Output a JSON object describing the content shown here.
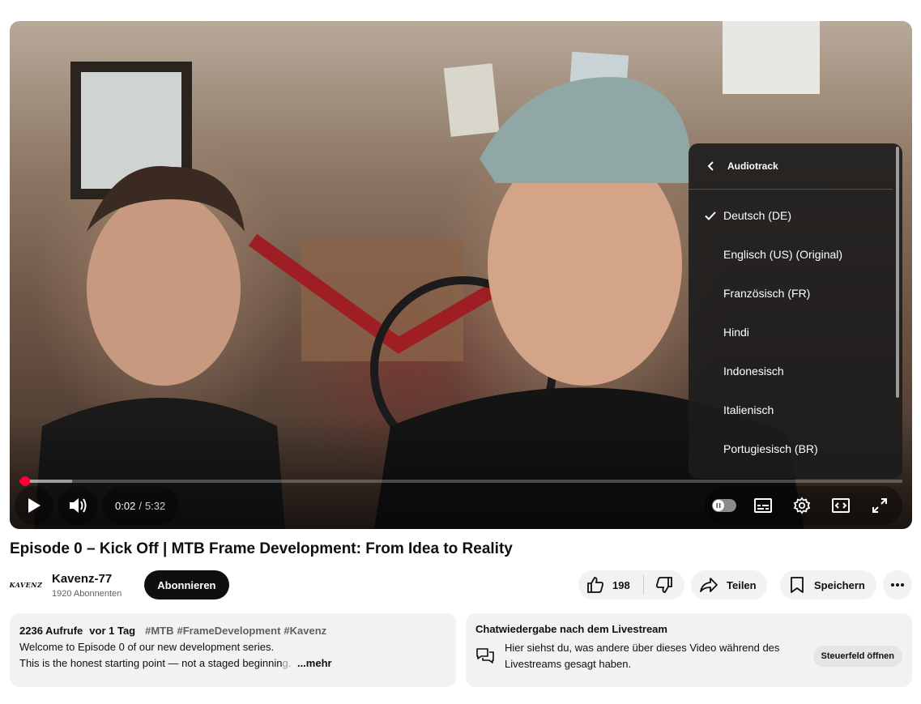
{
  "player": {
    "audio_menu": {
      "title": "Audiotrack",
      "selected_index": 0,
      "tracks": [
        "Deutsch (DE)",
        "Englisch (US) (Original)",
        "Französisch (FR)",
        "Hindi",
        "Indonesisch",
        "Italienisch",
        "Portugiesisch (BR)"
      ]
    },
    "time": {
      "current": "0:02",
      "separator": "/",
      "duration": "5:32"
    },
    "progress": {
      "played_fraction": 0.006,
      "buffered_fraction": 0.06
    },
    "accent_color": "#ff0033"
  },
  "video": {
    "title": "Episode 0 – Kick Off | MTB Frame Development: From Idea to Reality"
  },
  "channel": {
    "avatar_text": "KAVENZ",
    "name": "Kavenz-77",
    "subscribers": "1920 Abonnenten",
    "subscribe_label": "Abonnieren"
  },
  "actions": {
    "like_count": "198",
    "share_label": "Teilen",
    "save_label": "Speichern"
  },
  "description": {
    "views": "2236 Aufrufe",
    "age": "vor 1 Tag",
    "tags": [
      "#MTB",
      "#FrameDevelopment",
      "#Kavenz"
    ],
    "line1": "Welcome to Episode 0 of our new development series.",
    "line2_visible": "This is the honest starting point — not a staged beginnin",
    "line2_faded": "g.",
    "more_label": "...mehr"
  },
  "chat_replay": {
    "title": "Chatwiedergabe nach dem Livestream",
    "text": "Hier siehst du, was andere über dieses Video während des Livestreams gesagt haben.",
    "button_label": "Steuerfeld öffnen"
  }
}
